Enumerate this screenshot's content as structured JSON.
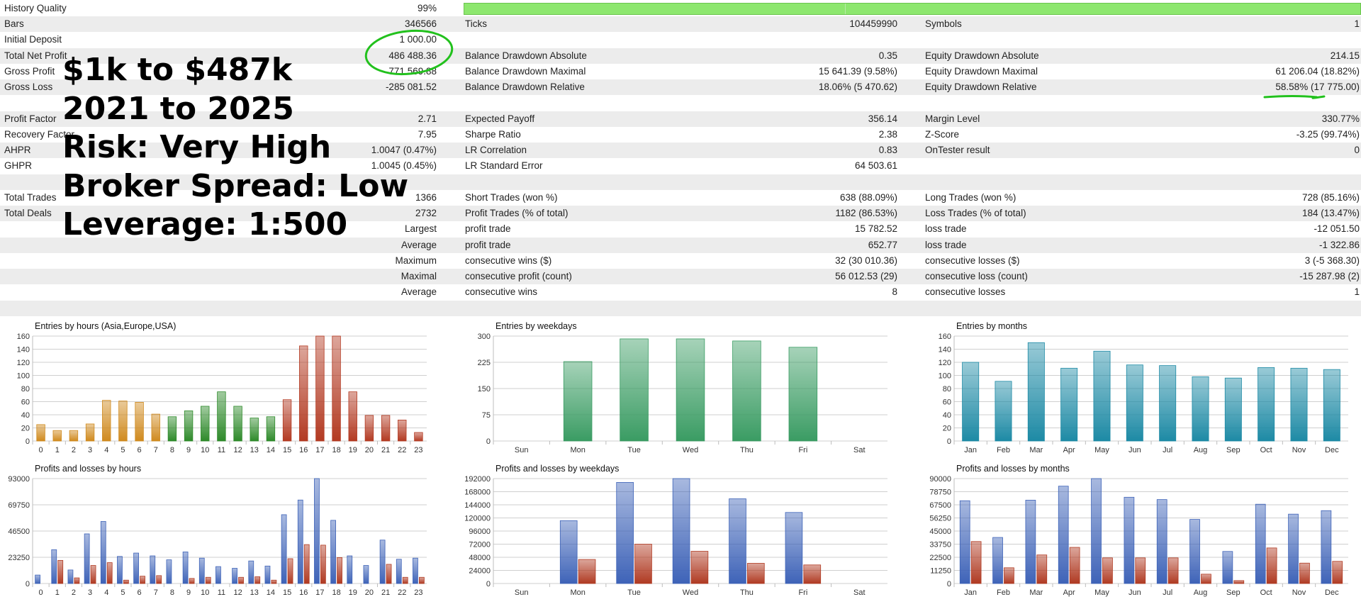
{
  "report": {
    "quality": {
      "label": "History Quality",
      "value": "99%"
    },
    "rows": [
      {
        "shade": true,
        "cells": [
          [
            "Bars",
            "346566"
          ],
          [
            "Ticks",
            "104459990"
          ],
          [
            "Symbols",
            "1"
          ]
        ]
      },
      {
        "shade": false,
        "cells": [
          [
            "Initial Deposit",
            "1 000.00"
          ],
          [
            "",
            ""
          ],
          [
            "",
            ""
          ]
        ]
      },
      {
        "shade": true,
        "cells": [
          [
            "Total Net Profit",
            "486 488.36"
          ],
          [
            "Balance Drawdown Absolute",
            "0.35"
          ],
          [
            "Equity Drawdown Absolute",
            "214.15"
          ]
        ]
      },
      {
        "shade": false,
        "cells": [
          [
            "Gross Profit",
            "771 569.88"
          ],
          [
            "Balance Drawdown Maximal",
            "15 641.39 (9.58%)"
          ],
          [
            "Equity Drawdown Maximal",
            "61 206.04 (18.82%)"
          ]
        ]
      },
      {
        "shade": true,
        "cells": [
          [
            "Gross Loss",
            "-285 081.52"
          ],
          [
            "Balance Drawdown Relative",
            "18.06% (5 470.62)"
          ],
          [
            "Equity Drawdown Relative",
            "58.58% (17 775.00)"
          ]
        ]
      },
      {
        "shade": false,
        "cells": [
          [
            "",
            ""
          ],
          [
            "",
            ""
          ],
          [
            "",
            ""
          ]
        ]
      },
      {
        "shade": true,
        "cells": [
          [
            "Profit Factor",
            "2.71"
          ],
          [
            "Expected Payoff",
            "356.14"
          ],
          [
            "Margin Level",
            "330.77%"
          ]
        ]
      },
      {
        "shade": false,
        "cells": [
          [
            "Recovery Factor",
            "7.95"
          ],
          [
            "Sharpe Ratio",
            "2.38"
          ],
          [
            "Z-Score",
            "-3.25 (99.74%)"
          ]
        ]
      },
      {
        "shade": true,
        "cells": [
          [
            "AHPR",
            "1.0047 (0.47%)"
          ],
          [
            "LR Correlation",
            "0.83"
          ],
          [
            "OnTester result",
            "0"
          ]
        ]
      },
      {
        "shade": false,
        "cells": [
          [
            "GHPR",
            "1.0045 (0.45%)"
          ],
          [
            "LR Standard Error",
            "64 503.61"
          ],
          [
            "",
            ""
          ]
        ]
      },
      {
        "shade": true,
        "cells": [
          [
            "",
            ""
          ],
          [
            "",
            ""
          ],
          [
            "",
            ""
          ]
        ]
      },
      {
        "shade": false,
        "cells": [
          [
            "Total Trades",
            "1366"
          ],
          [
            "Short Trades (won %)",
            "638 (88.09%)"
          ],
          [
            "Long Trades (won %)",
            "728 (85.16%)"
          ]
        ]
      },
      {
        "shade": true,
        "cells": [
          [
            "Total Deals",
            "2732"
          ],
          [
            "Profit Trades (% of total)",
            "1182 (86.53%)"
          ],
          [
            "Loss Trades (% of total)",
            "184 (13.47%)"
          ]
        ]
      },
      {
        "shade": false,
        "cells": [
          [
            "",
            "Largest"
          ],
          [
            "profit trade",
            "15 782.52"
          ],
          [
            "loss trade",
            "-12 051.50"
          ]
        ]
      },
      {
        "shade": true,
        "cells": [
          [
            "",
            "Average"
          ],
          [
            "profit trade",
            "652.77"
          ],
          [
            "loss trade",
            "-1 322.86"
          ]
        ]
      },
      {
        "shade": false,
        "cells": [
          [
            "",
            "Maximum"
          ],
          [
            "consecutive wins ($)",
            "32 (30 010.36)"
          ],
          [
            "consecutive losses ($)",
            "3 (-5 368.30)"
          ]
        ]
      },
      {
        "shade": true,
        "cells": [
          [
            "",
            "Maximal"
          ],
          [
            "consecutive profit (count)",
            "56 012.53 (29)"
          ],
          [
            "consecutive loss (count)",
            "-15 287.98 (2)"
          ]
        ]
      },
      {
        "shade": false,
        "cells": [
          [
            "",
            "Average"
          ],
          [
            "consecutive wins",
            "8"
          ],
          [
            "consecutive losses",
            "1"
          ]
        ]
      },
      {
        "shade": true,
        "cells": [
          [
            "",
            ""
          ],
          [
            "",
            ""
          ],
          [
            "",
            ""
          ]
        ]
      }
    ]
  },
  "overlay": {
    "lines": [
      "$1k to $487k",
      "2021 to 2025",
      "Risk: Very High",
      "Broker Spread: Low",
      "Leverage: 1:500"
    ]
  },
  "colors": {
    "asia": "#d08a1e",
    "europe": "#2e8a2a",
    "usa": "#b33a22",
    "weekday": "#3a9c63",
    "month": "#1d8aa5",
    "profit": "#3e63b8",
    "loss": "#b03a22",
    "annotation": "#22c11d",
    "quality": "#8de76e"
  },
  "chart_data": [
    {
      "type": "bar",
      "title": "Entries by hours (Asia,Europe,USA)",
      "categories": [
        "0",
        "1",
        "2",
        "3",
        "4",
        "5",
        "6",
        "7",
        "8",
        "9",
        "10",
        "11",
        "12",
        "13",
        "14",
        "15",
        "16",
        "17",
        "18",
        "19",
        "20",
        "21",
        "22",
        "23"
      ],
      "values": [
        25,
        16,
        16,
        26,
        62,
        61,
        59,
        41,
        37,
        46,
        53,
        75,
        53,
        35,
        37,
        63,
        145,
        160,
        160,
        75,
        39,
        39,
        32,
        13
      ],
      "groups": [
        "asia",
        "asia",
        "asia",
        "asia",
        "asia",
        "asia",
        "asia",
        "asia",
        "europe",
        "europe",
        "europe",
        "europe",
        "europe",
        "europe",
        "europe",
        "usa",
        "usa",
        "usa",
        "usa",
        "usa",
        "usa",
        "usa",
        "usa",
        "usa"
      ],
      "ylim": [
        0,
        160
      ],
      "yticks": [
        "0",
        "20",
        "40",
        "60",
        "80",
        "100",
        "120",
        "140",
        "160"
      ]
    },
    {
      "type": "bar",
      "title": "Entries by weekdays",
      "categories": [
        "Sun",
        "Mon",
        "Tue",
        "Wed",
        "Thu",
        "Fri",
        "Sat"
      ],
      "values": [
        0,
        227,
        292,
        292,
        286,
        268,
        0
      ],
      "ylim": [
        0,
        300
      ],
      "yticks": [
        "0",
        "75",
        "150",
        "225",
        "300"
      ]
    },
    {
      "type": "bar",
      "title": "Entries by months",
      "categories": [
        "Jan",
        "Feb",
        "Mar",
        "Apr",
        "May",
        "Jun",
        "Jul",
        "Aug",
        "Sep",
        "Oct",
        "Nov",
        "Dec"
      ],
      "values": [
        120,
        91,
        150,
        111,
        137,
        116,
        115,
        98,
        96,
        112,
        111,
        109
      ],
      "ylim": [
        0,
        160
      ],
      "yticks": [
        "0",
        "20",
        "40",
        "60",
        "80",
        "100",
        "120",
        "140",
        "160"
      ]
    },
    {
      "type": "bar",
      "title": "Profits and losses by hours",
      "categories": [
        "0",
        "1",
        "2",
        "3",
        "4",
        "5",
        "6",
        "7",
        "8",
        "9",
        "10",
        "11",
        "12",
        "13",
        "14",
        "15",
        "16",
        "17",
        "18",
        "19",
        "20",
        "21",
        "22",
        "23"
      ],
      "series": [
        {
          "name": "profit",
          "values": [
            7500,
            30000,
            12000,
            44000,
            55000,
            24000,
            27000,
            24500,
            21000,
            28000,
            22500,
            15000,
            13500,
            20000,
            15500,
            61000,
            74000,
            93000,
            56000,
            24500,
            16000,
            38500,
            21500,
            22500
          ]
        },
        {
          "name": "loss",
          "values": [
            0,
            20500,
            5000,
            16000,
            18500,
            3000,
            6500,
            7000,
            0,
            4500,
            5500,
            0,
            5500,
            6000,
            3000,
            22000,
            34500,
            34000,
            23000,
            0,
            0,
            17000,
            5500,
            5500
          ]
        }
      ],
      "ylim": [
        0,
        93000
      ],
      "yticks": [
        "0",
        "23250",
        "46500",
        "69750",
        "93000"
      ]
    },
    {
      "type": "bar",
      "title": "Profits and losses by weekdays",
      "categories": [
        "Sun",
        "Mon",
        "Tue",
        "Wed",
        "Thu",
        "Fri",
        "Sat"
      ],
      "series": [
        {
          "name": "profit",
          "values": [
            0,
            115000,
            185000,
            192000,
            155000,
            130000,
            0
          ]
        },
        {
          "name": "loss",
          "values": [
            0,
            44000,
            72000,
            59000,
            37000,
            34000,
            0
          ]
        }
      ],
      "ylim": [
        0,
        192000
      ],
      "yticks": [
        "0",
        "24000",
        "48000",
        "72000",
        "96000",
        "120000",
        "144000",
        "168000",
        "192000"
      ]
    },
    {
      "type": "bar",
      "title": "Profits and losses by months",
      "categories": [
        "Jan",
        "Feb",
        "Mar",
        "Apr",
        "May",
        "Jun",
        "Jul",
        "Aug",
        "Sep",
        "Oct",
        "Nov",
        "Dec"
      ],
      "series": [
        {
          "name": "profit",
          "values": [
            71000,
            39500,
            71500,
            83500,
            90000,
            74000,
            72000,
            55000,
            27500,
            68000,
            59500,
            62500
          ]
        },
        {
          "name": "loss",
          "values": [
            36000,
            13500,
            24500,
            31000,
            22000,
            22000,
            22000,
            8000,
            2500,
            30500,
            17500,
            19000
          ]
        }
      ],
      "ylim": [
        0,
        90000
      ],
      "yticks": [
        "0",
        "11250",
        "22500",
        "33750",
        "45000",
        "56250",
        "67500",
        "78750",
        "90000"
      ]
    }
  ]
}
